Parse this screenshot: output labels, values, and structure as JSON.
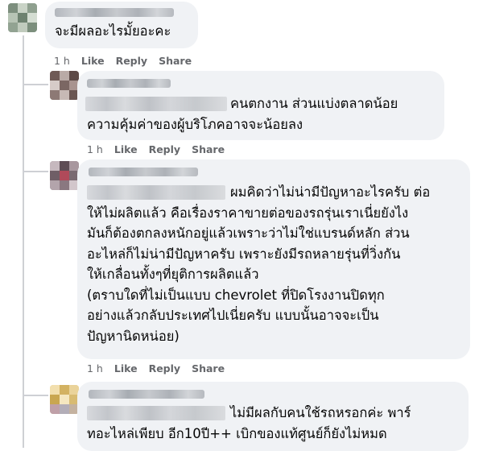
{
  "comments": [
    {
      "text": "จะมีผลอะไรมั้ยอะคะ",
      "time": "1 h",
      "actions": [
        "Like",
        "Reply",
        "Share"
      ]
    },
    {
      "text": "คนตกงาน ส่วนแบ่งตลาดน้อย\nความคุ้มค่าของผู้บริโภคอาจจะน้อยลง",
      "time": "1 h",
      "actions": [
        "Like",
        "Reply",
        "Share"
      ]
    },
    {
      "text": "ผมคิดว่าไม่น่ามีปัญหาอะไรครับ ต่อ\nให้ไม่ผลิตแล้ว คือเรื่องราคาขายต่อของรถรุ่นเราเนี่ยยังไง\nมันก็ต้องตกลงหนักอยู่แล้วเพราะว่าไม่ใช่แบรนด์หลัก ส่วน\nอะไหล่ก็ไม่น่ามีปัญหาครับ เพราะยังมีรถหลายรุ่นที่วิ่งกัน\nให้เกลื่อนทั้งๆที่ยุติการผลิตแล้ว\n(ตราบใดที่ไม่เป็นแบบ chevrolet ที่ปิดโรงงานปิดทุก\nอย่างแล้วกลับประเทศไปเนี่ยครับ แบบนั้นอาจจะเป็น\nปัญหานิดหน่อย)",
      "time": "1 h",
      "actions": [
        "Like",
        "Reply",
        "Share"
      ]
    },
    {
      "text": "ไม่มีผลกับคนใช้รถหรอกค่ะ พาร์\nทอะไหล่เพียบ อีก10ปี++ เบิกของแท้ศูนย์ก็ยังไม่หมด"
    }
  ]
}
